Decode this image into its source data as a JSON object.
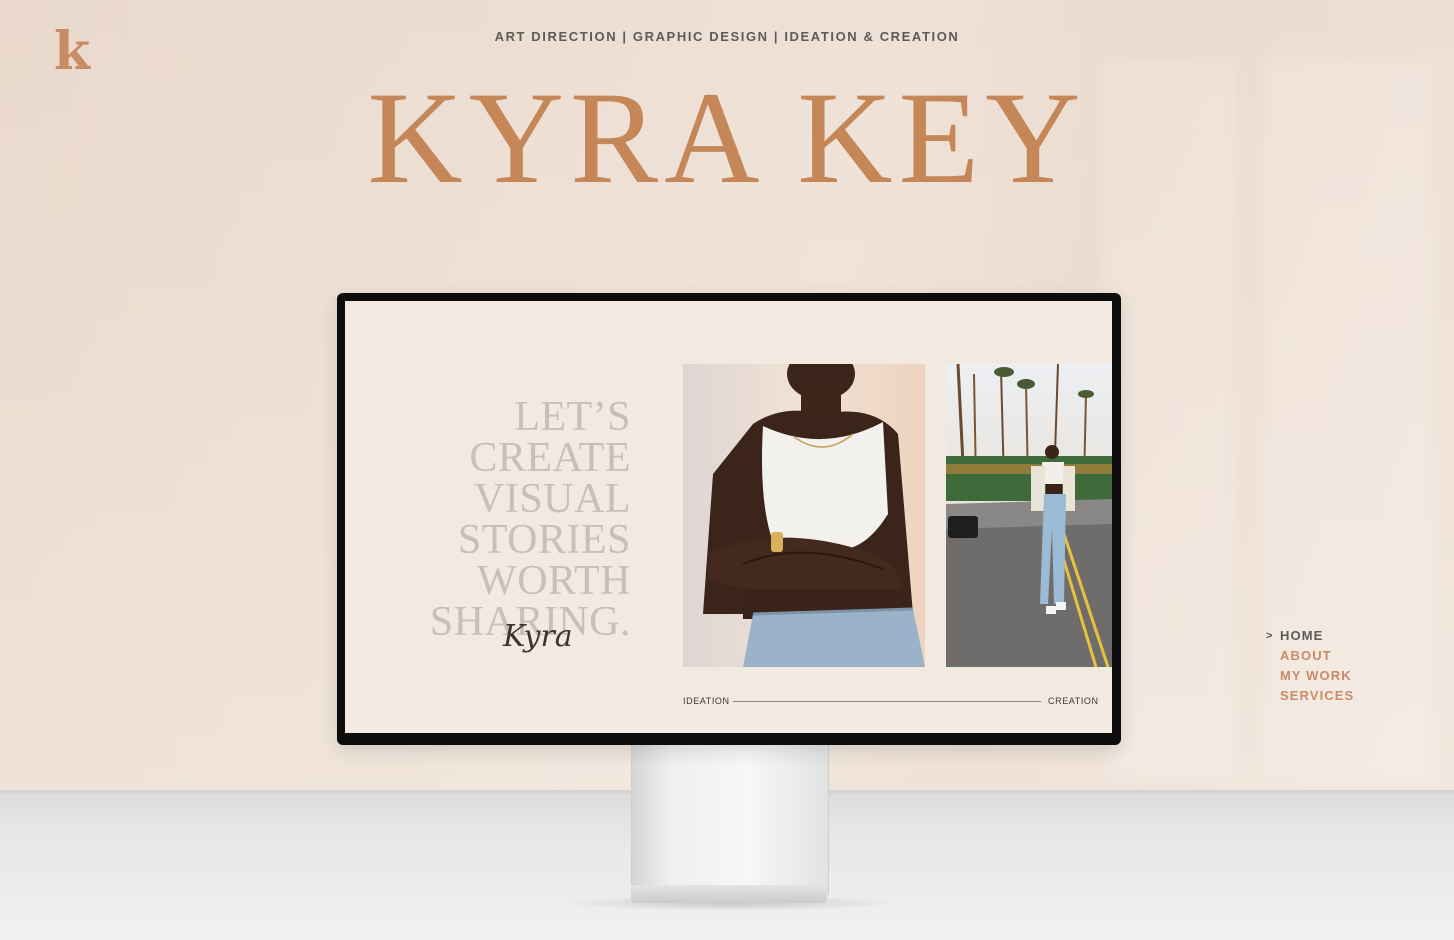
{
  "brand": {
    "logo_letter": "k",
    "tagline": "ART DIRECTION | GRAPHIC DESIGN | IDEATION & CREATION",
    "name": "KYRA KEY",
    "accent_color": "#c58658",
    "text_color": "#5e5a57"
  },
  "screen": {
    "headline_lines": [
      "LET’S",
      "CREATE",
      "VISUAL",
      "STORIES",
      "WORTH",
      "SHARING."
    ],
    "signature": "Kyra",
    "axis_left": "IDEATION",
    "axis_right": "CREATION",
    "photo_1_icon": "portrait-photo",
    "photo_2_icon": "street-photo"
  },
  "nav": {
    "active_marker": ">",
    "items": [
      {
        "label": "HOME",
        "active": true
      },
      {
        "label": "ABOUT",
        "active": false
      },
      {
        "label": "MY WORK",
        "active": false
      },
      {
        "label": "SERVICES",
        "active": false
      }
    ]
  }
}
